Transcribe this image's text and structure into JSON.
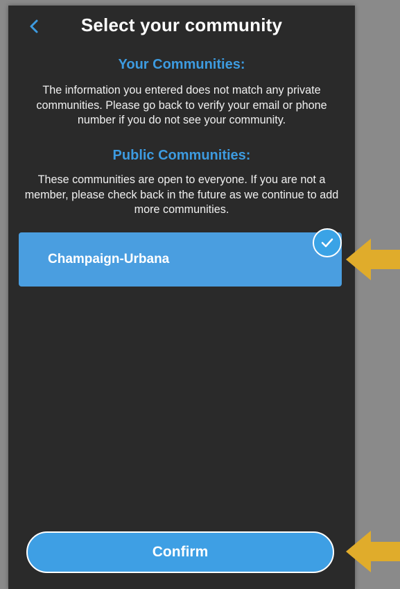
{
  "header": {
    "title": "Select your community",
    "back_icon": "chevron-left-icon"
  },
  "your_communities": {
    "heading": "Your Communities:",
    "text": "The information you entered does not match any private communities. Please go back to verify your email or phone number if you do not see your community."
  },
  "public_communities": {
    "heading": "Public Communities:",
    "text": "These communities are open to everyone. If you are not a member, please check back in the future as we continue to add more communities.",
    "items": [
      {
        "name": "Champaign-Urbana",
        "selected": true
      }
    ]
  },
  "confirm": {
    "label": "Confirm"
  },
  "colors": {
    "background": "#2a2a2a",
    "accent": "#3d9be0",
    "card": "#4a9ee0",
    "annotation_arrow": "#e0ac2b"
  }
}
